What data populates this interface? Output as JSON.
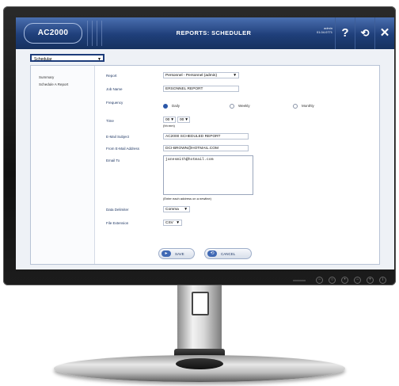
{
  "header": {
    "logo": "AC2000",
    "title": "REPORTS: SCHEDULER",
    "user_name": "admin",
    "user_detail": "01.04.0771",
    "help_icon": "question-mark-icon",
    "logout_icon": "logout-arrow-icon",
    "close_icon": "close-icon"
  },
  "module_select": {
    "value": "Schedular"
  },
  "nav": {
    "items": [
      "Summary",
      "Schedule A Report"
    ]
  },
  "form": {
    "report_label": "Report",
    "report_value": "Personnel - Personnel (admin)",
    "job_name_label": "Job Name",
    "job_name_value": "ERSONNEL REPORT",
    "frequency_label": "Frequency",
    "frequency_options": [
      "Daily",
      "Weekly",
      "Monthly"
    ],
    "frequency_selected": "Daily",
    "time_label": "Time",
    "time_hour": "00",
    "time_minute": "00",
    "time_format": "(hh:mm)",
    "email_subject_label": "E-Mail Subject",
    "email_subject_value": "AC2000 SCHEDULED REPORT",
    "from_email_label": "From E-Mail Address",
    "from_email_value": "DCI-BROWN@HOTMAIL.COM",
    "email_to_label": "Email To",
    "email_to_value": "janesmith@hotmail.com",
    "email_to_hint": "(Enter each address on a newline)",
    "delimiter_label": "Data Delimiter",
    "delimiter_value": "Comma",
    "extension_label": "File Extension",
    "extension_value": "CSV"
  },
  "buttons": {
    "save": "SAVE",
    "cancel": "CANCEL"
  },
  "colors": {
    "header": "#1f3f7a",
    "accent": "#2b57a8",
    "bezel": "#1a1a1a"
  }
}
